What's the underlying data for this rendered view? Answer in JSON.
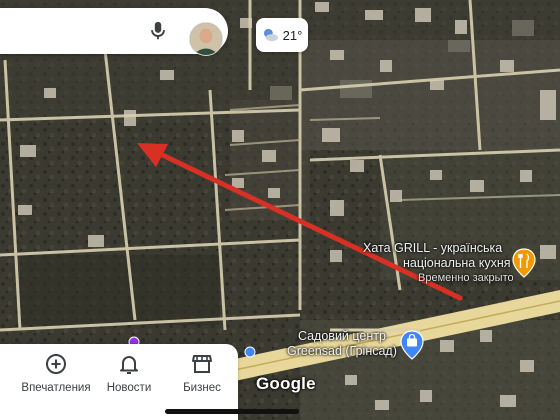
{
  "brand": {
    "logo_text": "Google"
  },
  "search_bar": {
    "mic_icon": "microphone-icon",
    "avatar_icon": "user-avatar"
  },
  "weather": {
    "temperature": "21°",
    "icon": "partly-cloudy-night-icon"
  },
  "bottom_nav": {
    "items": [
      {
        "label": "Впечатления",
        "icon": "add-circle-icon"
      },
      {
        "label": "Новости",
        "icon": "bell-icon"
      },
      {
        "label": "Бизнес",
        "icon": "storefront-icon"
      }
    ]
  },
  "places": [
    {
      "name_line1": "Хата GRILL - українська",
      "name_line2": "національна кухня",
      "status": "Временно закрыто",
      "icon": "restaurant-fork-knife-icon"
    },
    {
      "name_line1": "Садовий центр",
      "name_line2": "Greensad (Грінсад)",
      "icon": "shopping-bag-pin-icon"
    }
  ],
  "annotation": {
    "arrow_color": "#d93025"
  },
  "colors": {
    "road": "#d9d0b0",
    "highway": "#e8d79a",
    "pin_orange": "#f29900",
    "pin_blue": "#4285f4",
    "pin_purple": "#9334e6"
  }
}
